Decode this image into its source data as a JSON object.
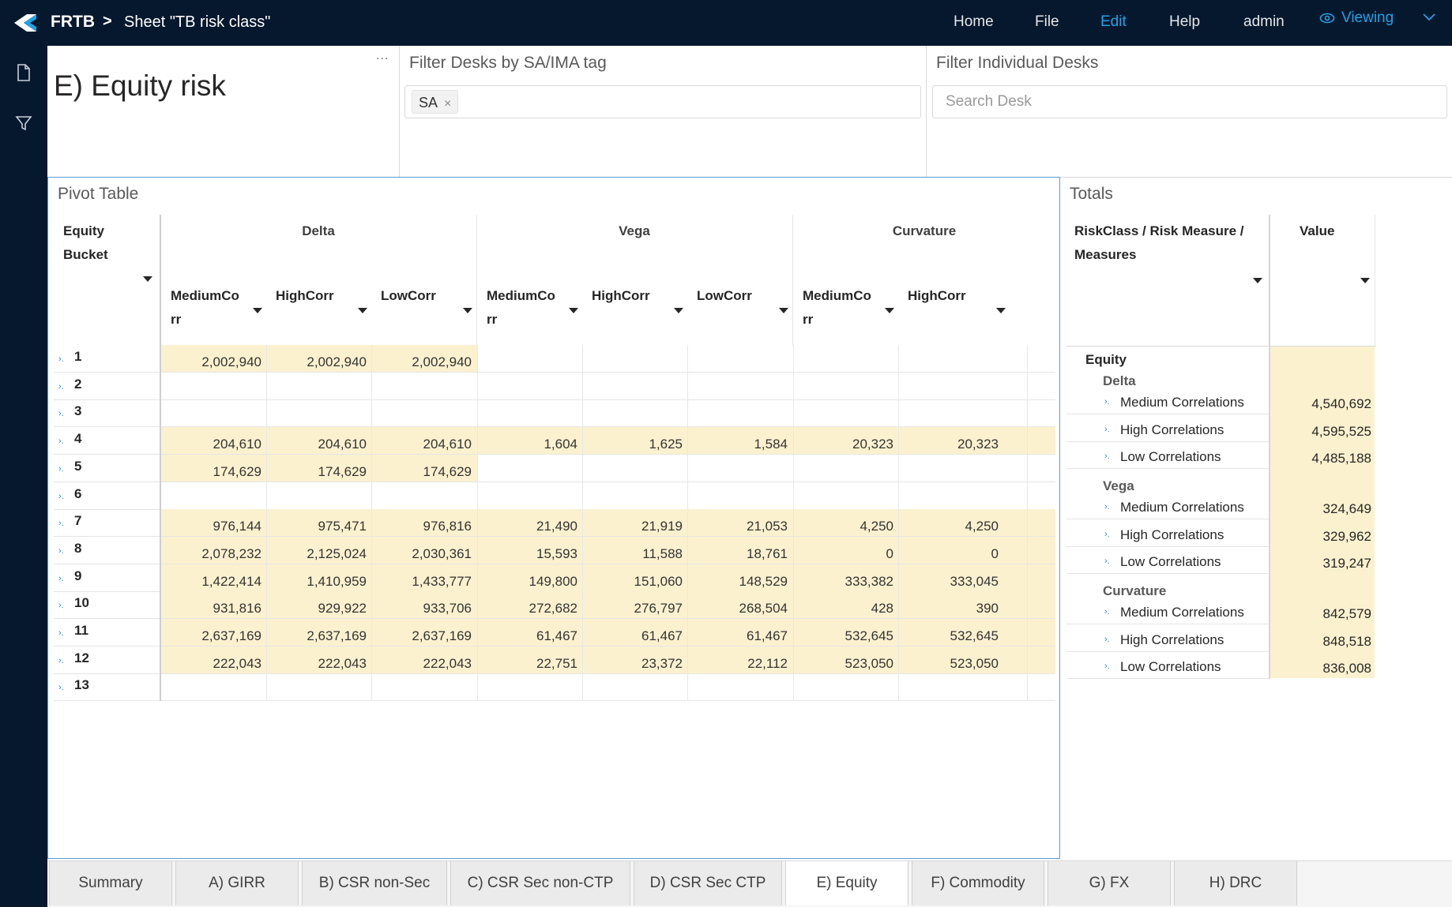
{
  "header": {
    "app_name": "FRTB",
    "separator": ">",
    "sheet_title": "Sheet \"TB risk class\"",
    "menu": [
      "Home",
      "File",
      "Edit",
      "Help",
      "admin"
    ],
    "viewing_label": "Viewing",
    "accent_color": "#1fa3e6"
  },
  "left_sidebar": {
    "icons": [
      "document-icon",
      "filter-icon"
    ]
  },
  "title_panel": {
    "title": "E) Equity risk",
    "menu_dots": "..."
  },
  "filter_tag_panel": {
    "label": "Filter Desks by SA/IMA tag",
    "selected_tags": [
      "SA"
    ],
    "remove_glyph": "×"
  },
  "filter_desk_panel": {
    "label": "Filter Individual Desks",
    "placeholder": "Search Desk"
  },
  "pivot": {
    "label": "Pivot Table",
    "bucket_header_line1": "Equity",
    "bucket_header_line2": "Bucket",
    "groups": [
      "Delta",
      "Vega",
      "Curvature"
    ],
    "columns": [
      {
        "l1": "MediumCo",
        "l2": "rr"
      },
      {
        "l1": "HighCorr",
        "l2": ""
      },
      {
        "l1": "LowCorr",
        "l2": ""
      },
      {
        "l1": "MediumCo",
        "l2": "rr"
      },
      {
        "l1": "HighCorr",
        "l2": ""
      },
      {
        "l1": "LowCorr",
        "l2": ""
      },
      {
        "l1": "MediumCo",
        "l2": "rr"
      },
      {
        "l1": "HighCorr",
        "l2": ""
      }
    ],
    "highlight_color": "#fcf1cf",
    "rows": [
      {
        "bucket": "1",
        "values": [
          "2,002,940",
          "2,002,940",
          "2,002,940",
          "",
          "",
          "",
          "",
          ""
        ]
      },
      {
        "bucket": "2",
        "values": [
          "",
          "",
          "",
          "",
          "",
          "",
          "",
          ""
        ]
      },
      {
        "bucket": "3",
        "values": [
          "",
          "",
          "",
          "",
          "",
          "",
          "",
          ""
        ]
      },
      {
        "bucket": "4",
        "values": [
          "204,610",
          "204,610",
          "204,610",
          "1,604",
          "1,625",
          "1,584",
          "20,323",
          "20,323"
        ]
      },
      {
        "bucket": "5",
        "values": [
          "174,629",
          "174,629",
          "174,629",
          "",
          "",
          "",
          "",
          ""
        ]
      },
      {
        "bucket": "6",
        "values": [
          "",
          "",
          "",
          "",
          "",
          "",
          "",
          ""
        ]
      },
      {
        "bucket": "7",
        "values": [
          "976,144",
          "975,471",
          "976,816",
          "21,490",
          "21,919",
          "21,053",
          "4,250",
          "4,250"
        ]
      },
      {
        "bucket": "8",
        "values": [
          "2,078,232",
          "2,125,024",
          "2,030,361",
          "15,593",
          "11,588",
          "18,761",
          "0",
          "0"
        ]
      },
      {
        "bucket": "9",
        "values": [
          "1,422,414",
          "1,410,959",
          "1,433,777",
          "149,800",
          "151,060",
          "148,529",
          "333,382",
          "333,045"
        ]
      },
      {
        "bucket": "10",
        "values": [
          "931,816",
          "929,922",
          "933,706",
          "272,682",
          "276,797",
          "268,504",
          "428",
          "390"
        ]
      },
      {
        "bucket": "11",
        "values": [
          "2,637,169",
          "2,637,169",
          "2,637,169",
          "61,467",
          "61,467",
          "61,467",
          "532,645",
          "532,645"
        ]
      },
      {
        "bucket": "12",
        "values": [
          "222,043",
          "222,043",
          "222,043",
          "22,751",
          "23,372",
          "22,112",
          "523,050",
          "523,050"
        ]
      },
      {
        "bucket": "13",
        "values": [
          "",
          "",
          "",
          "",
          "",
          "",
          "",
          ""
        ]
      }
    ]
  },
  "totals": {
    "label": "Totals",
    "col_header_line1": "RiskClass / Risk Measure /",
    "col_header_line2": "Measures",
    "value_header": "Value",
    "root": "Equity",
    "groups": [
      {
        "name": "Delta",
        "items": [
          {
            "name": "Medium Correlations",
            "value": "4,540,692"
          },
          {
            "name": "High Correlations",
            "value": "4,595,525"
          },
          {
            "name": "Low Correlations",
            "value": "4,485,188"
          }
        ]
      },
      {
        "name": "Vega",
        "items": [
          {
            "name": "Medium Correlations",
            "value": "324,649"
          },
          {
            "name": "High Correlations",
            "value": "329,962"
          },
          {
            "name": "Low Correlations",
            "value": "319,247"
          }
        ]
      },
      {
        "name": "Curvature",
        "items": [
          {
            "name": "Medium Correlations",
            "value": "842,579"
          },
          {
            "name": "High Correlations",
            "value": "848,518"
          },
          {
            "name": "Low Correlations",
            "value": "836,008"
          }
        ]
      }
    ]
  },
  "sheet_tabs": {
    "items": [
      "Summary",
      "A) GIRR",
      "B) CSR non-Sec",
      "C) CSR Sec non-CTP",
      "D) CSR Sec CTP",
      "E) Equity",
      "F) Commodity",
      "G) FX",
      "H) DRC"
    ],
    "active": "E) Equity"
  }
}
